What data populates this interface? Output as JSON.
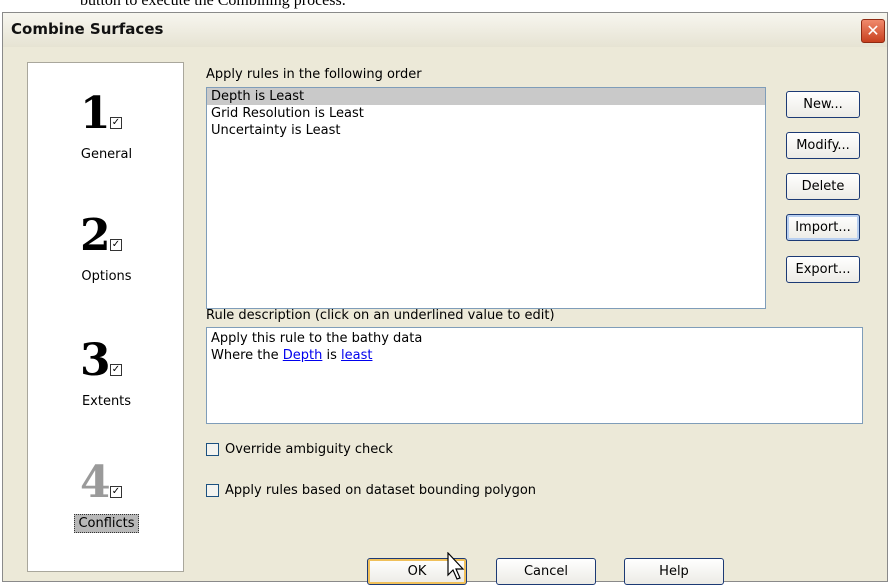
{
  "background_text": "button to execute the Combining process.",
  "window": {
    "title": "Combine Surfaces",
    "close_glyph": "✕"
  },
  "steps": [
    {
      "number": "1",
      "label": "General",
      "checked": true
    },
    {
      "number": "2",
      "label": "Options",
      "checked": true
    },
    {
      "number": "3",
      "label": "Extents",
      "checked": true
    },
    {
      "number": "4",
      "label": "Conflicts",
      "checked": true,
      "active": true
    }
  ],
  "rules": {
    "heading": "Apply rules in the following order",
    "items": [
      {
        "text": "Depth is Least",
        "selected": true
      },
      {
        "text": "Grid Resolution is Least",
        "selected": false
      },
      {
        "text": "Uncertainty is Least",
        "selected": false
      }
    ]
  },
  "side_buttons": {
    "new": "New...",
    "modify": "Modify...",
    "delete": "Delete",
    "import": "Import...",
    "export": "Export..."
  },
  "description": {
    "heading": "Rule description (click on an underlined value to edit)",
    "line1": "Apply this rule to the bathy data",
    "line2_prefix": "Where the ",
    "line2_link1": "Depth",
    "line2_mid": " is ",
    "line2_link2": "least"
  },
  "options": {
    "override_ambiguity": {
      "label": "Override ambiguity check",
      "checked": false
    },
    "bounding_polygon": {
      "label": "Apply rules based on dataset bounding polygon",
      "checked": false
    }
  },
  "footer": {
    "ok": "OK",
    "cancel": "Cancel",
    "help": "Help"
  },
  "colors": {
    "link": "#0000ee",
    "selection": "#c9c9c9",
    "dialog_bg": "#ece9d8"
  },
  "icons": {
    "close": "close-icon",
    "cursor": "mouse-pointer-icon"
  }
}
